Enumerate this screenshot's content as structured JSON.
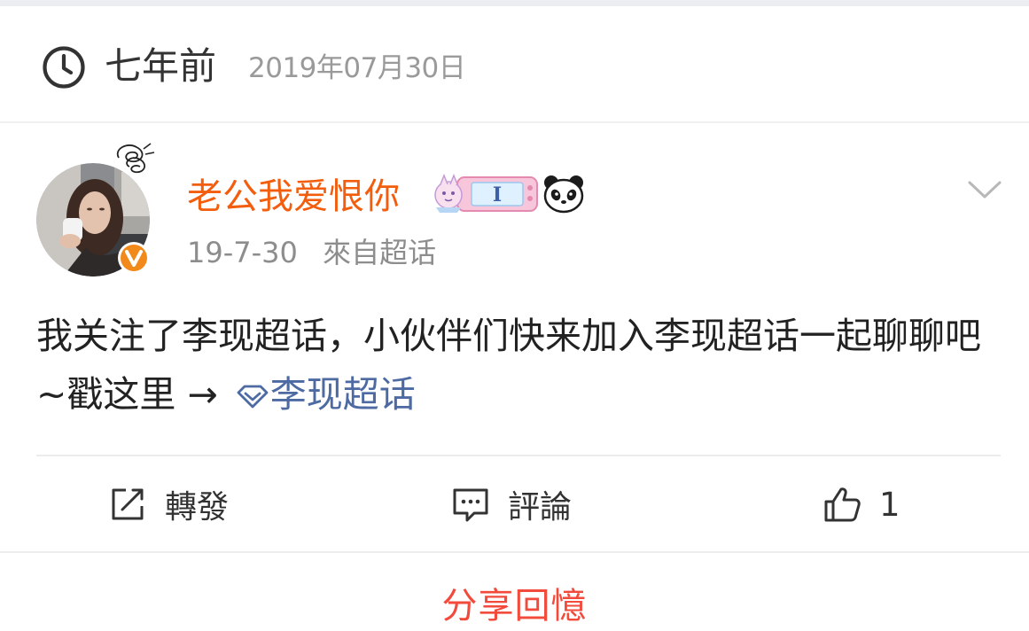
{
  "memory": {
    "relative_time": "七年前",
    "date": "2019年07月30日"
  },
  "post": {
    "author": {
      "name": "老公我爱恨你",
      "avatar": "avatar",
      "verified_icon": "verified-v-icon",
      "badges": [
        "game-console-badge",
        "panda-icon"
      ]
    },
    "time": "19-7-30",
    "source": "來自超话",
    "text_prefix": "我关注了李现超话，小伙伴们快来加入李现超话一起聊聊吧~戳这里 → ",
    "topic_link": "李现超话",
    "more_icon": "chevron-down-icon"
  },
  "actions": {
    "forward_label": "轉發",
    "comment_label": "評論",
    "like_count": "1"
  },
  "share_label": "分享回憶",
  "colors": {
    "username": "#f25d0e",
    "topic_link": "#4d6aa3",
    "share": "#f24a3b",
    "meta": "#8d8d8d"
  }
}
